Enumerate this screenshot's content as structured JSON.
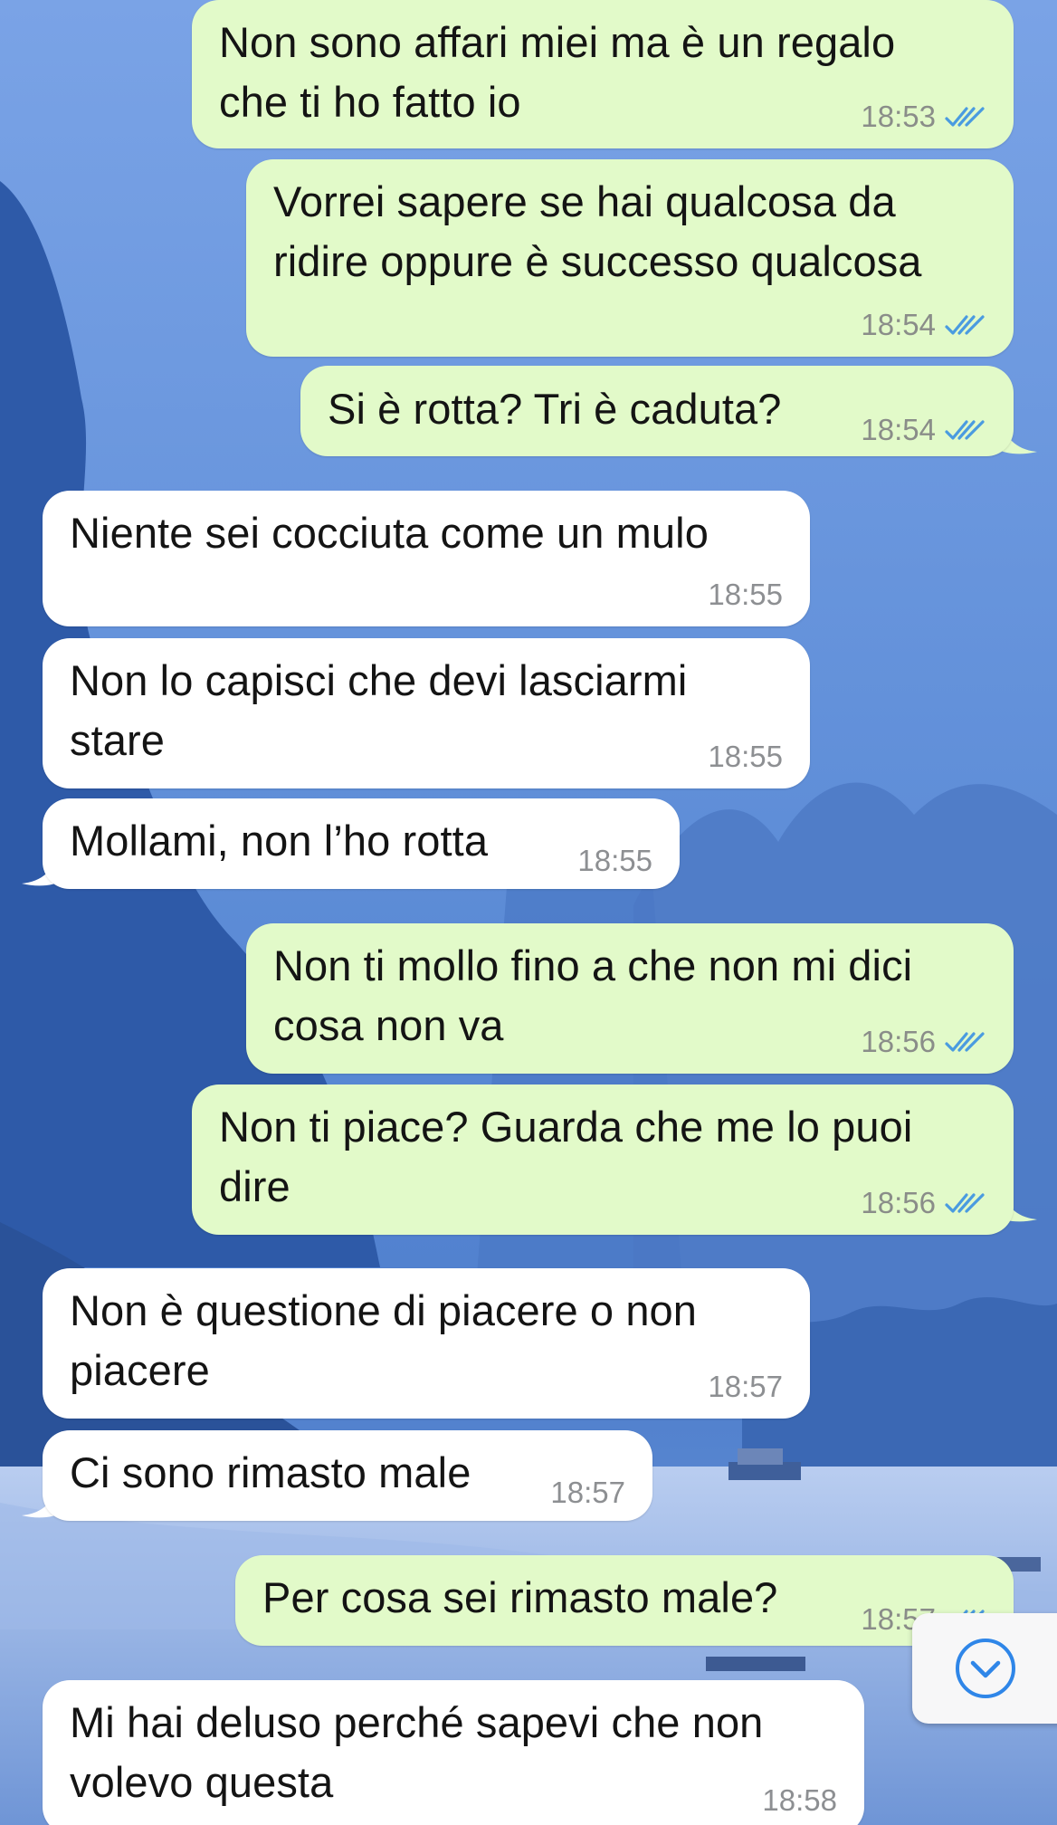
{
  "colors": {
    "outgoing_bubble": "#e2fac9",
    "incoming_bubble": "#ffffff",
    "read_ticks": "#4a9be0",
    "background_sky": "#5b8ad6",
    "scroll_button_accent": "#2f86e8"
  },
  "messages": [
    {
      "direction": "outgoing",
      "text": "Non sono affari miei ma è un regalo\nche ti ho fatto io",
      "time": "18:53",
      "status": "read-double-tick-icon"
    },
    {
      "direction": "outgoing",
      "text": "Vorrei sapere se hai qualcosa da\nridire oppure è successo qualcosa",
      "time": "18:54",
      "status": "read-double-tick-icon"
    },
    {
      "direction": "outgoing",
      "text": "Si è rotta? Tri è caduta?",
      "time": "18:54",
      "status": "read-double-tick-icon"
    },
    {
      "direction": "incoming",
      "text": "Niente sei cocciuta come un mulo",
      "time": "18:55"
    },
    {
      "direction": "incoming",
      "text": "Non lo capisci che devi lasciarmi\nstare",
      "time": "18:55"
    },
    {
      "direction": "incoming",
      "text": "Mollami, non l’ho rotta",
      "time": "18:55"
    },
    {
      "direction": "outgoing",
      "text": "Non ti mollo fino a che non mi dici\ncosa non va",
      "time": "18:56",
      "status": "read-double-tick-icon"
    },
    {
      "direction": "outgoing",
      "text": "Non ti piace? Guarda che me lo puoi\ndire",
      "time": "18:56",
      "status": "read-double-tick-icon"
    },
    {
      "direction": "incoming",
      "text": "Non è questione di piacere o non\npiacere",
      "time": "18:57"
    },
    {
      "direction": "incoming",
      "text": "Ci sono rimasto male",
      "time": "18:57"
    },
    {
      "direction": "outgoing",
      "text": "Per cosa sei rimasto male?",
      "time": "18:57",
      "status": "read-double-tick-icon"
    },
    {
      "direction": "incoming",
      "text": "Mi hai deluso perché sapevi che non\nvolevo questa",
      "time": "18:58"
    }
  ],
  "scroll_button": {
    "icon": "chevron-down-circle-icon"
  }
}
